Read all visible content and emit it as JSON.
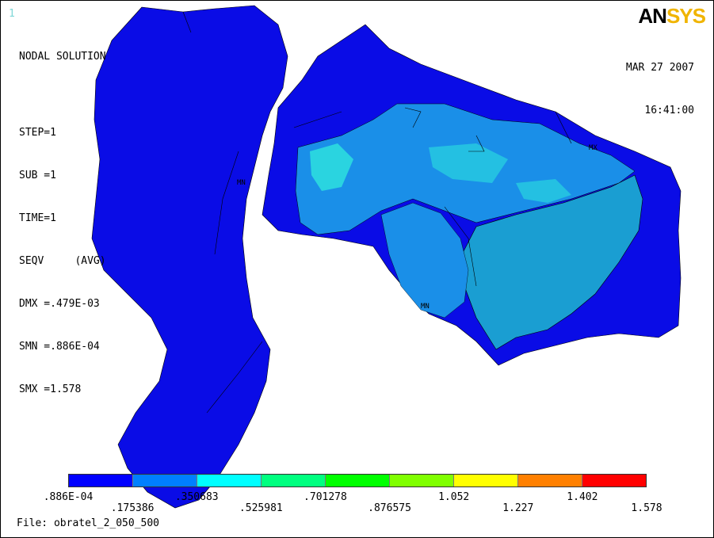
{
  "window_number": "1",
  "logo": {
    "an": "AN",
    "sys": "SYS"
  },
  "info": {
    "title": "NODAL SOLUTION",
    "step": "STEP=1",
    "sub": "SUB =1",
    "time": "TIME=1",
    "seqv": "SEQV     (AVG)",
    "dmx": "DMX =.479E-03",
    "smn": "SMN =.886E-04",
    "smx": "SMX =1.578"
  },
  "date": "MAR 27 2007",
  "time_of_day": "16:41:00",
  "markers": {
    "mn": "MN",
    "mx": "MX"
  },
  "legend": {
    "colors": [
      "#0000ff",
      "#0080ff",
      "#00ffff",
      "#00ff80",
      "#00ff00",
      "#80ff00",
      "#ffff00",
      "#ff8000",
      "#ff0000"
    ],
    "labels_upper": [
      ".886E-04",
      ".350683",
      ".701278",
      "1.052",
      "1.402"
    ],
    "labels_lower": [
      ".175386",
      ".525981",
      ".876575",
      "1.227",
      "1.578"
    ]
  },
  "file_label": "File: obratel_2_050_500"
}
